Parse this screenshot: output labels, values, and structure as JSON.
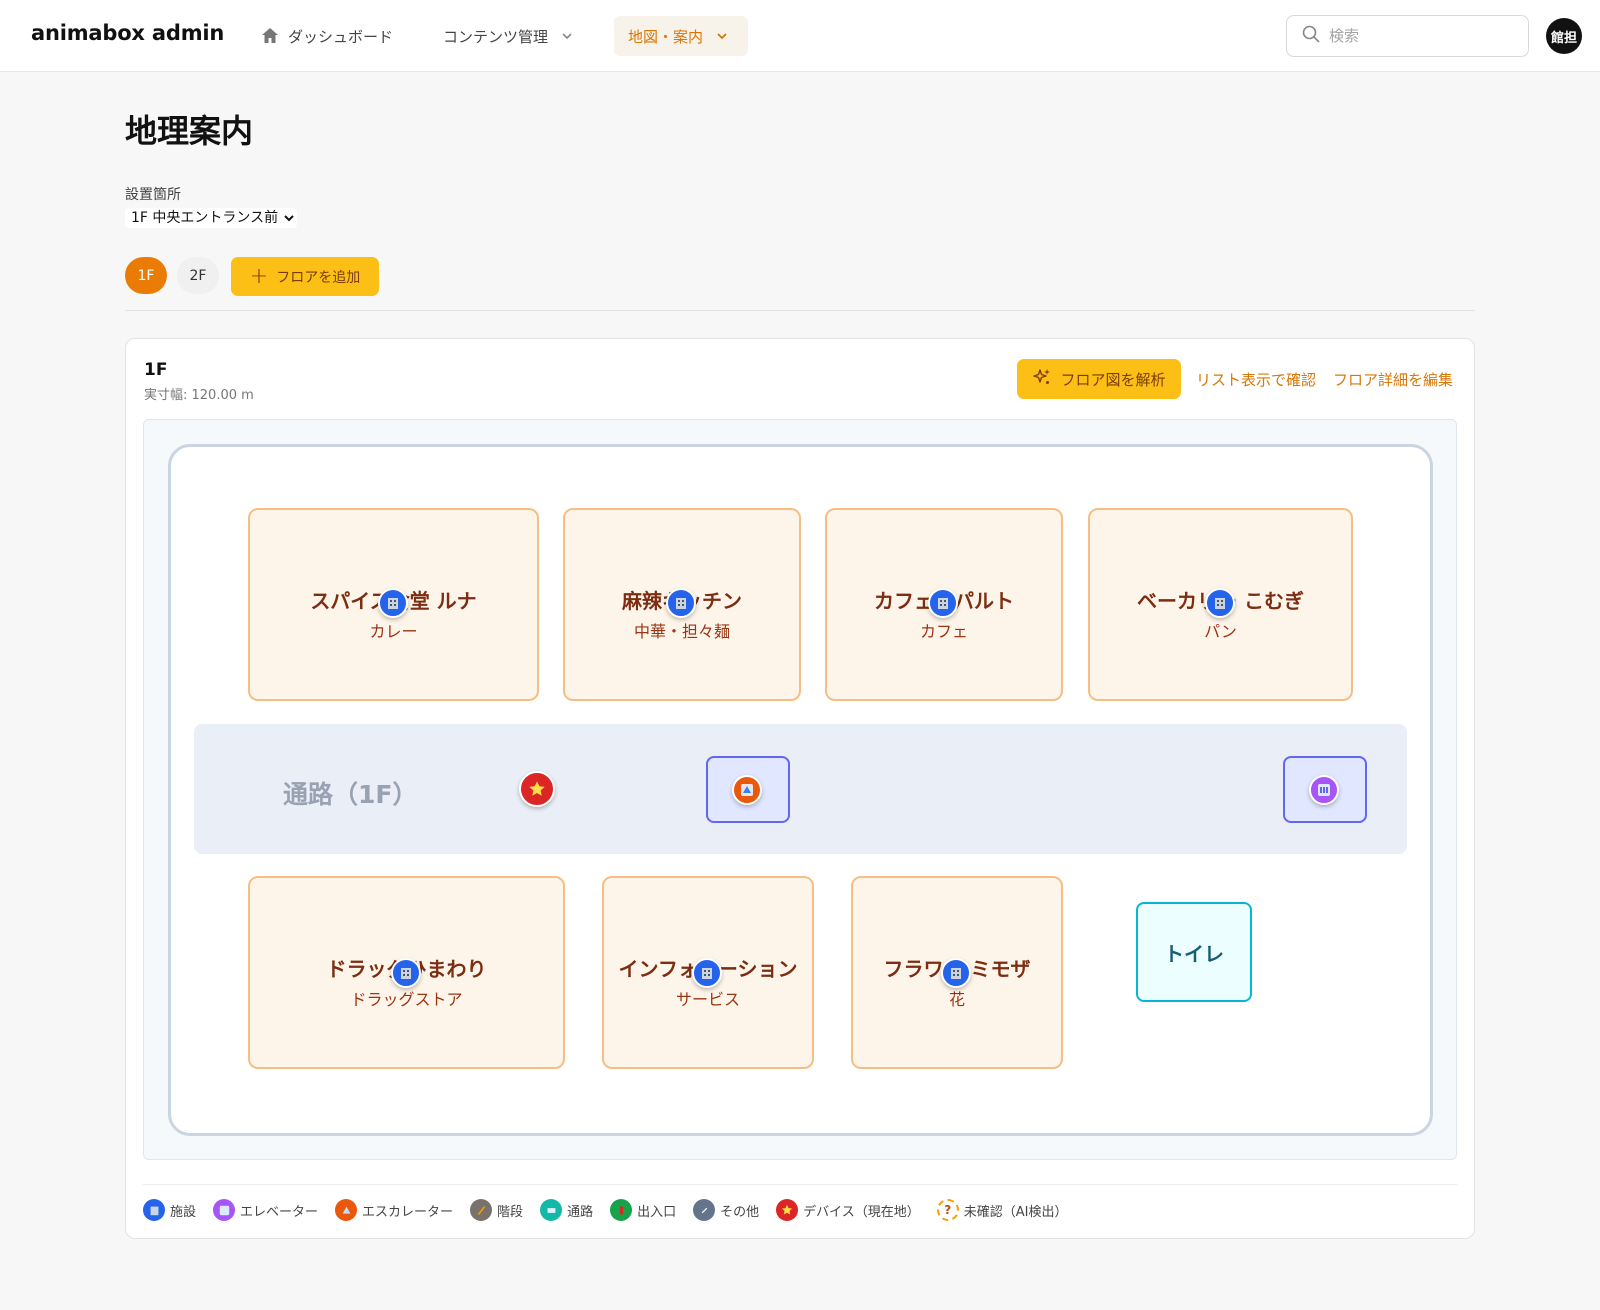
{
  "header": {
    "brand": "animabox admin",
    "nav": {
      "dashboard": "ダッシュボード",
      "content": "コンテンツ管理",
      "map": "地図・案内"
    },
    "search_placeholder": "検索",
    "avatar_text": "館担"
  },
  "page": {
    "title": "地理案内",
    "location_label": "設置箇所",
    "location_value": "1F 中央エントランス前",
    "floor_tabs": [
      "1F",
      "2F"
    ],
    "active_floor": "1F",
    "add_floor_label": "フロアを追加"
  },
  "floor_card": {
    "title": "1F",
    "width_text": "実寸幅: 120.00 m",
    "analyze_label": "フロア図を解析",
    "list_view_label": "リスト表示で確認",
    "edit_label": "フロア詳細を編集"
  },
  "map": {
    "stores_top": [
      {
        "name": "スパイス食堂 ルナ",
        "category": "カレー"
      },
      {
        "name": "麻辣キッチン",
        "category": "中華・担々麺"
      },
      {
        "name": "カフェ・パルト",
        "category": "カフェ"
      },
      {
        "name": "ベーカリー こむぎ",
        "category": "パン"
      }
    ],
    "stores_bottom": [
      {
        "name": "ドラッグひまわり",
        "category": "ドラッグストア"
      },
      {
        "name": "インフォメーション",
        "category": "サービス"
      },
      {
        "name": "フラワー ミモザ",
        "category": "花"
      }
    ],
    "corridor_label": "通路（1F）",
    "toilet_label": "トイレ"
  },
  "legend": [
    {
      "label": "施設",
      "color": "#2563eb",
      "icon": "building-icon"
    },
    {
      "label": "エレベーター",
      "color": "#a855f7",
      "icon": "elevator-icon"
    },
    {
      "label": "エスカレーター",
      "color": "#ea580c",
      "icon": "escalator-icon"
    },
    {
      "label": "階段",
      "color": "#78716c",
      "icon": "stairs-icon"
    },
    {
      "label": "通路",
      "color": "#14b8a6",
      "icon": "passage-icon"
    },
    {
      "label": "出入口",
      "color": "#16a34a",
      "icon": "door-icon"
    },
    {
      "label": "その他",
      "color": "#64748b",
      "icon": "link-icon"
    },
    {
      "label": "デバイス（現在地）",
      "color": "#dc2626",
      "icon": "star-icon"
    },
    {
      "label": "未確認（AI検出）",
      "color": "#f59e0b",
      "icon": "question-icon"
    }
  ]
}
